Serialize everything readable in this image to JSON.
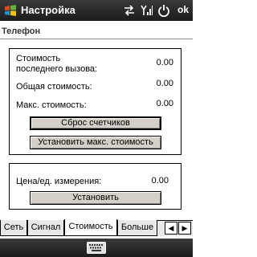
{
  "window": {
    "title": "Настройка",
    "ok_label": "ok"
  },
  "status_icons": [
    "sync-icon",
    "signal-icon",
    "power-icon"
  ],
  "page": {
    "section_title": "Телефон"
  },
  "cost_group": {
    "last_call_label": "Стоимость\nпоследнего вызова:",
    "last_call_value": "0.00",
    "total_label": "Общая стоимость:",
    "total_value": "0.00",
    "max_label": "Макс. стоимость:",
    "max_value": "0.00",
    "reset_button": "Сброс счетчиков",
    "set_max_button": "Установить макс. стоимость"
  },
  "unit_group": {
    "price_label": "Цена/ед. измерения:",
    "price_value": "0.00",
    "set_button": "Установить"
  },
  "tabs": [
    {
      "label": "Сеть",
      "active": false
    },
    {
      "label": "Сигнал",
      "active": false
    },
    {
      "label": "Стоимость",
      "active": true
    },
    {
      "label": "Больше",
      "active": false
    }
  ],
  "bottom": {
    "keyboard_icon": "keyboard-icon"
  },
  "colors": {
    "titlebar": "#2a2a2a",
    "button_face": "#d4d0c8"
  }
}
